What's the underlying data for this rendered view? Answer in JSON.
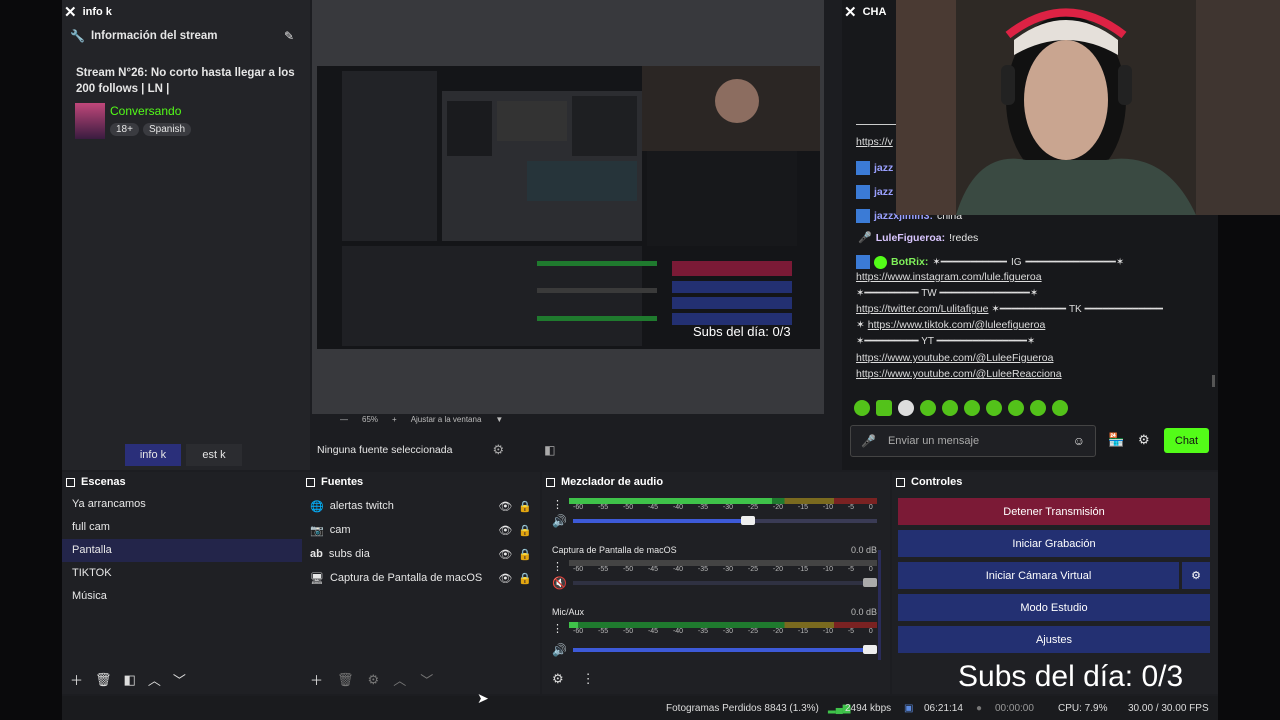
{
  "info_dock": {
    "tab_title": "info k",
    "section_title": "Información del stream",
    "stream_title": "Stream N°26: No corto hasta llegar a los 200 follows | LN |",
    "category": "Conversando",
    "tags": [
      "18+",
      "Spanish"
    ],
    "tabs": [
      "info k",
      "est k"
    ]
  },
  "preview": {
    "zoom": "65%",
    "fit_label": "Ajustar a la ventana",
    "no_source": "Ninguna fuente seleccionada",
    "overlay_text": "Subs del día: 0/3"
  },
  "chat": {
    "tab_title": "CHA",
    "messages": [
      {
        "user": "jazz",
        "text": "",
        "color": "#9aa0ff"
      },
      {
        "user": "jazz",
        "text": "",
        "color": "#9aa0ff"
      },
      {
        "user": "jazzxjimin3:",
        "text": "china",
        "color": "#9aa0ff"
      },
      {
        "user": "LuleFigueroa:",
        "text": "!redes",
        "color": "#d9c6ff"
      },
      {
        "user": "BotRix:",
        "text": "",
        "color": "#7ff05a"
      }
    ],
    "links": [
      "https://www.instagram.com/lule.figueroa",
      "https://twitter.com/Lulitafigue",
      "https://www.tiktok.com/@luleefigueroa",
      "https://www.youtube.com/@LuleeFigueroa",
      "https://www.youtube.com/@LuleeReacciona"
    ],
    "partial_link": "https://v",
    "rule_labels": [
      "IG",
      "TW",
      "TK",
      "YT"
    ],
    "input_placeholder": "Enviar un mensaje",
    "send_label": "Chat"
  },
  "scenes": {
    "title": "Escenas",
    "items": [
      "Ya arrancamos",
      "full cam",
      "Pantalla",
      "TIKTOK",
      "Música"
    ],
    "active_index": 2
  },
  "sources": {
    "title": "Fuentes",
    "items": [
      {
        "label": "alertas twitch",
        "icon": "globe-icon"
      },
      {
        "label": "cam",
        "icon": "camera-icon"
      },
      {
        "label": "subs dia",
        "icon": "text-icon"
      },
      {
        "label": "Captura de Pantalla de macOS",
        "icon": "monitor-icon"
      }
    ]
  },
  "mixer": {
    "title": "Mezclador de audio",
    "scale": [
      "-60",
      "-55",
      "-50",
      "-45",
      "-40",
      "-35",
      "-30",
      "-25",
      "-20",
      "-15",
      "-10",
      "-5",
      "0"
    ],
    "channels": [
      {
        "name": "",
        "db": "",
        "level": 0.66,
        "volume": 0.6
      },
      {
        "name": "Captura de Pantalla de macOS",
        "db": "0.0 dB",
        "level": 0.0,
        "volume": 1.0
      },
      {
        "name": "Mic/Aux",
        "db": "0.0 dB",
        "level": 0.03,
        "volume": 1.0
      }
    ]
  },
  "controls": {
    "title": "Controles",
    "stop_stream": "Detener Transmisión",
    "start_recording": "Iniciar Grabación",
    "start_virtual_cam": "Iniciar Cámara Virtual",
    "studio_mode": "Modo Estudio",
    "settings": "Ajustes",
    "colors": {
      "stop": "#7b1a36",
      "normal": "#233072"
    }
  },
  "overlay_big": "Subs del día: 0/3",
  "status": {
    "dropped": "Fotogramas Perdidos 8843 (1.3%)",
    "bitrate": "2494 kbps",
    "stream_time": "06:21:14",
    "rec_time": "00:00:00",
    "cpu": "CPU: 7.9%",
    "fps": "30.00 / 30.00 FPS"
  }
}
